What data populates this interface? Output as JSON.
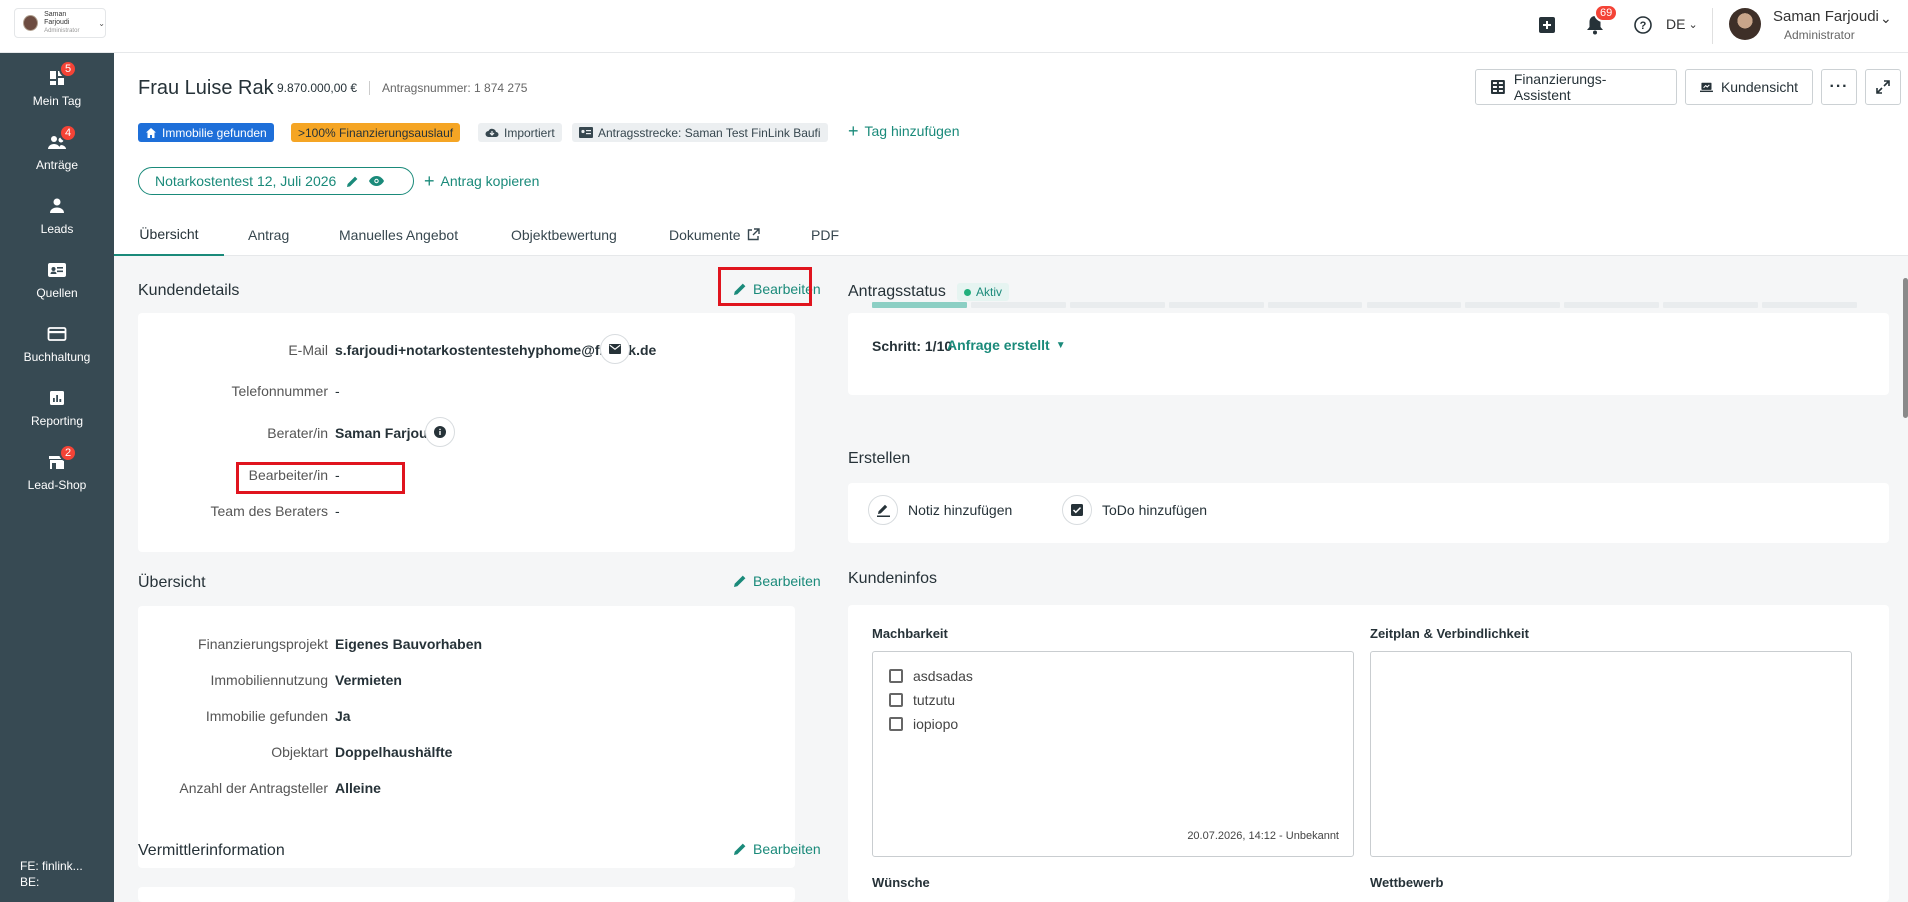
{
  "brand": {
    "name": "Saman Farjoudi",
    "role": "Administrator"
  },
  "topbar": {
    "notifications_count": "69",
    "language": "DE",
    "user_name": "Saman Farjoudi",
    "user_role": "Administrator"
  },
  "sidebar": {
    "items": [
      {
        "label": "Mein Tag",
        "badge": "5"
      },
      {
        "label": "Anträge",
        "badge": "4"
      },
      {
        "label": "Leads",
        "badge": ""
      },
      {
        "label": "Quellen",
        "badge": ""
      },
      {
        "label": "Buchhaltung",
        "badge": ""
      },
      {
        "label": "Reporting",
        "badge": ""
      },
      {
        "label": "Lead-Shop",
        "badge": "2"
      }
    ],
    "footer_fe": "FE: finlink...",
    "footer_be": "BE:"
  },
  "header": {
    "title": "Frau Luise Rak",
    "amount": "9.870.000,00 €",
    "antragsnummer": "Antragsnummer: 1 874 275",
    "btn_assistant": "Finanzierungs-Assistent",
    "btn_customer_view": "Kundensicht"
  },
  "tags": {
    "t1": "Immobilie gefunden",
    "t2": ">100% Finanzierungsauslauf",
    "t3": "Importiert",
    "t4": "Antragsstrecke: Saman Test FinLink Baufi",
    "add": "Tag hinzufügen"
  },
  "application": {
    "name": "Notarkostentest 12, Juli 2026",
    "copy": "Antrag kopieren"
  },
  "tabs": [
    "Übersicht",
    "Antrag",
    "Manuelles Angebot",
    "Objektbewertung",
    "Dokumente",
    "PDF"
  ],
  "kundendetails": {
    "title": "Kundendetails",
    "edit": "Bearbeiten",
    "rows": [
      {
        "label": "E-Mail",
        "value": "s.farjoudi+notarkostentestehyphome@finlink.de"
      },
      {
        "label": "Telefonnummer",
        "value": "-"
      },
      {
        "label": "Berater/in",
        "value": "Saman Farjoudi"
      },
      {
        "label": "Bearbeiter/in",
        "value": "-"
      },
      {
        "label": "Team des Beraters",
        "value": "-"
      }
    ]
  },
  "uebersicht": {
    "title": "Übersicht",
    "edit": "Bearbeiten",
    "rows": [
      {
        "label": "Finanzierungsprojekt",
        "value": "Eigenes Bauvorhaben"
      },
      {
        "label": "Immobiliennutzung",
        "value": "Vermieten"
      },
      {
        "label": "Immobilie gefunden",
        "value": "Ja"
      },
      {
        "label": "Objektart",
        "value": "Doppelhaushälfte"
      },
      {
        "label": "Anzahl der Antragsteller",
        "value": "Alleine"
      }
    ]
  },
  "vermittler": {
    "title": "Vermittlerinformation",
    "edit": "Bearbeiten"
  },
  "antragsstatus": {
    "title": "Antragsstatus",
    "status": "Aktiv",
    "step": "Schritt: 1/10",
    "step_name": "Anfrage erstellt",
    "current_step": 1,
    "total_steps": 10
  },
  "erstellen": {
    "title": "Erstellen",
    "note": "Notiz hinzufügen",
    "todo": "ToDo hinzufügen"
  },
  "kundeninfos": {
    "title": "Kundeninfos",
    "machbarkeit": "Machbarkeit",
    "machbarkeit_items": [
      "asdsadas",
      "tutzutu",
      "iopiopo"
    ],
    "machbarkeit_meta": "20.07.2026, 14:12 - Unbekannt",
    "zeitplan": "Zeitplan & Verbindlichkeit",
    "wuensche": "Wünsche",
    "wettbewerb": "Wettbewerb"
  },
  "colors": {
    "accent": "#1a8a7a",
    "sidebar": "#374a53",
    "highlight": "#e0141e",
    "badge": "#f44336"
  }
}
